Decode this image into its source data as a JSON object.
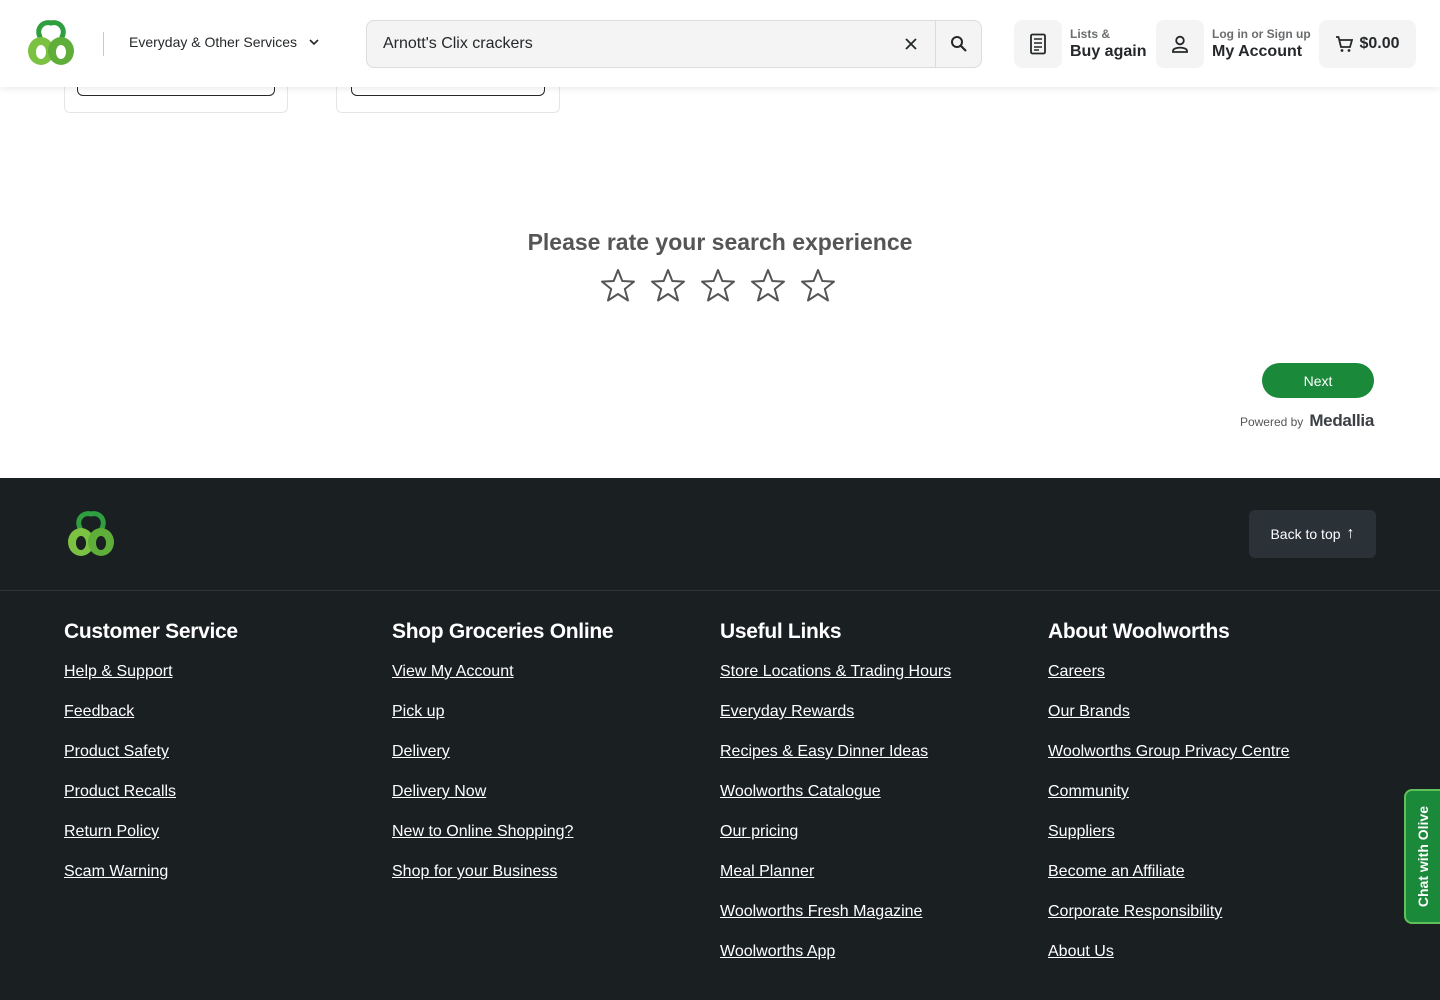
{
  "header": {
    "services_label": "Everyday & Other Services",
    "search_value": "Arnott's Clix crackers",
    "lists_small": "Lists &",
    "lists_big": "Buy again",
    "account_small": "Log in or Sign up",
    "account_big": "My Account",
    "cart_total": "$0.00"
  },
  "survey": {
    "title": "Please rate your search experience",
    "star_count": 5,
    "next_label": "Next",
    "powered_by": "Powered by",
    "brand": "Medallia"
  },
  "footer": {
    "back_to_top": "Back to top",
    "columns": [
      {
        "heading": "Customer Service",
        "links": [
          "Help & Support",
          "Feedback",
          "Product Safety",
          "Product Recalls",
          "Return Policy",
          "Scam Warning"
        ]
      },
      {
        "heading": "Shop Groceries Online",
        "links": [
          "View My Account",
          "Pick up",
          "Delivery",
          "Delivery Now",
          "New to Online Shopping?",
          "Shop for your Business"
        ]
      },
      {
        "heading": "Useful Links",
        "links": [
          "Store Locations & Trading Hours",
          "Everyday Rewards",
          "Recipes & Easy Dinner Ideas",
          "Woolworths Catalogue",
          "Our pricing",
          "Meal Planner",
          "Woolworths Fresh Magazine",
          "Woolworths App"
        ]
      },
      {
        "heading": "About Woolworths",
        "links": [
          "Careers",
          "Our Brands",
          "Woolworths Group Privacy Centre",
          "Community",
          "Suppliers",
          "Become an Affiliate",
          "Corporate Responsibility",
          "About Us"
        ]
      }
    ]
  },
  "chat": {
    "label": "Chat with Olive"
  },
  "colors": {
    "brand_green": "#1a8a3a",
    "footer_bg": "#1a1f22",
    "logo_green": "#7bc242"
  }
}
